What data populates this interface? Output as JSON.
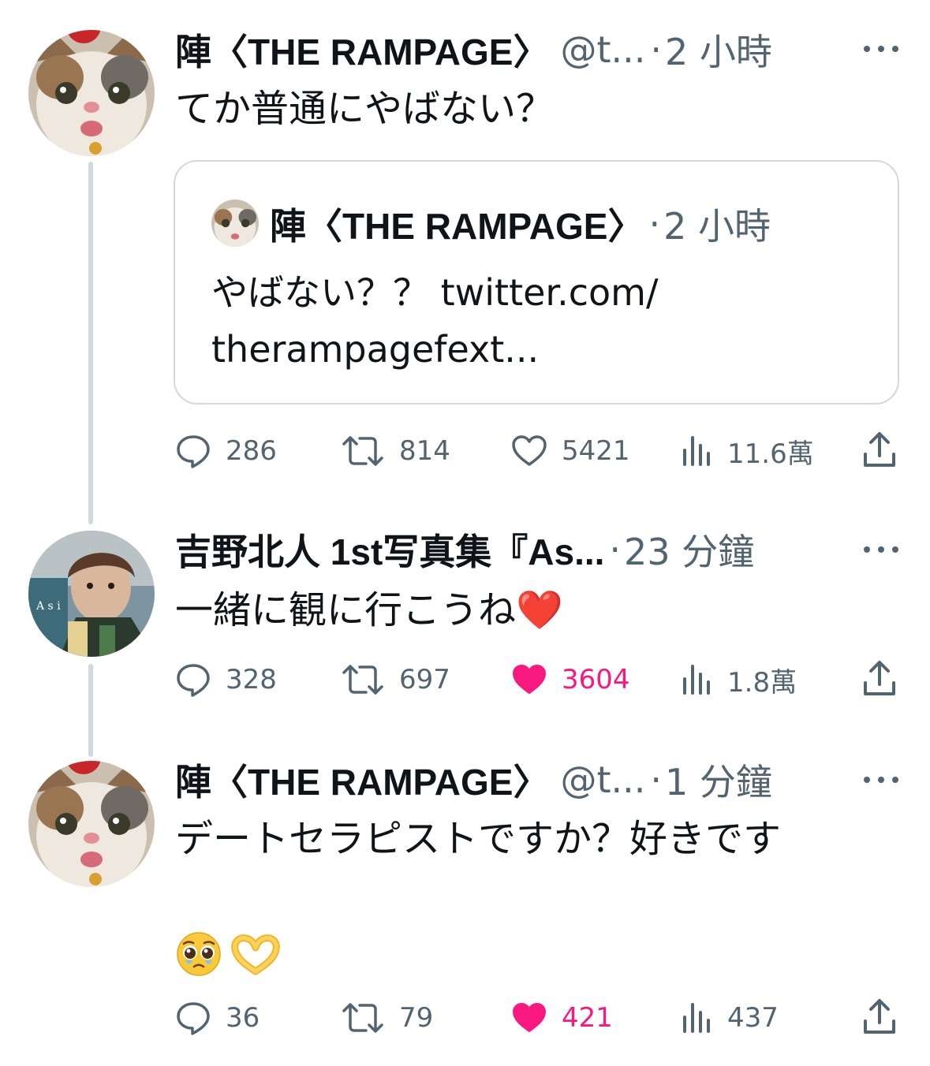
{
  "tweets": [
    {
      "name": "陣〈THE RAMPAGE〉",
      "handle": "@t...",
      "time": "2 小時",
      "text": "てか普通にやばない？",
      "quote": {
        "name": "陣〈THE RAMPAGE〉",
        "time": "2 小時",
        "text": "やばない？？ twitter.com/\ntherampagefext..."
      },
      "stats": {
        "replies": "286",
        "retweets": "814",
        "likes": "5421",
        "views": "11.6萬"
      },
      "liked": false
    },
    {
      "name": "吉野北人 1st写真集『As...",
      "time": "23 分鐘",
      "text": "一緒に観に行こうね❤️",
      "stats": {
        "replies": "328",
        "retweets": "697",
        "likes": "3604",
        "views": "1.8萬"
      },
      "liked": true
    },
    {
      "name": "陣〈THE RAMPAGE〉",
      "handle": "@t...",
      "time": "1 分鐘",
      "text": "デートセラピストですか？好きです",
      "emojis": "🥹🫶",
      "stats": {
        "replies": "36",
        "retweets": "79",
        "likes": "421",
        "views": "437"
      },
      "liked": true
    }
  ],
  "colors": {
    "text": "#0f1419",
    "muted": "#536471",
    "like": "#f91880",
    "border": "#cfd9de"
  },
  "icons": [
    "more-icon",
    "reply-icon",
    "retweet-icon",
    "like-icon",
    "views-icon",
    "share-icon"
  ]
}
